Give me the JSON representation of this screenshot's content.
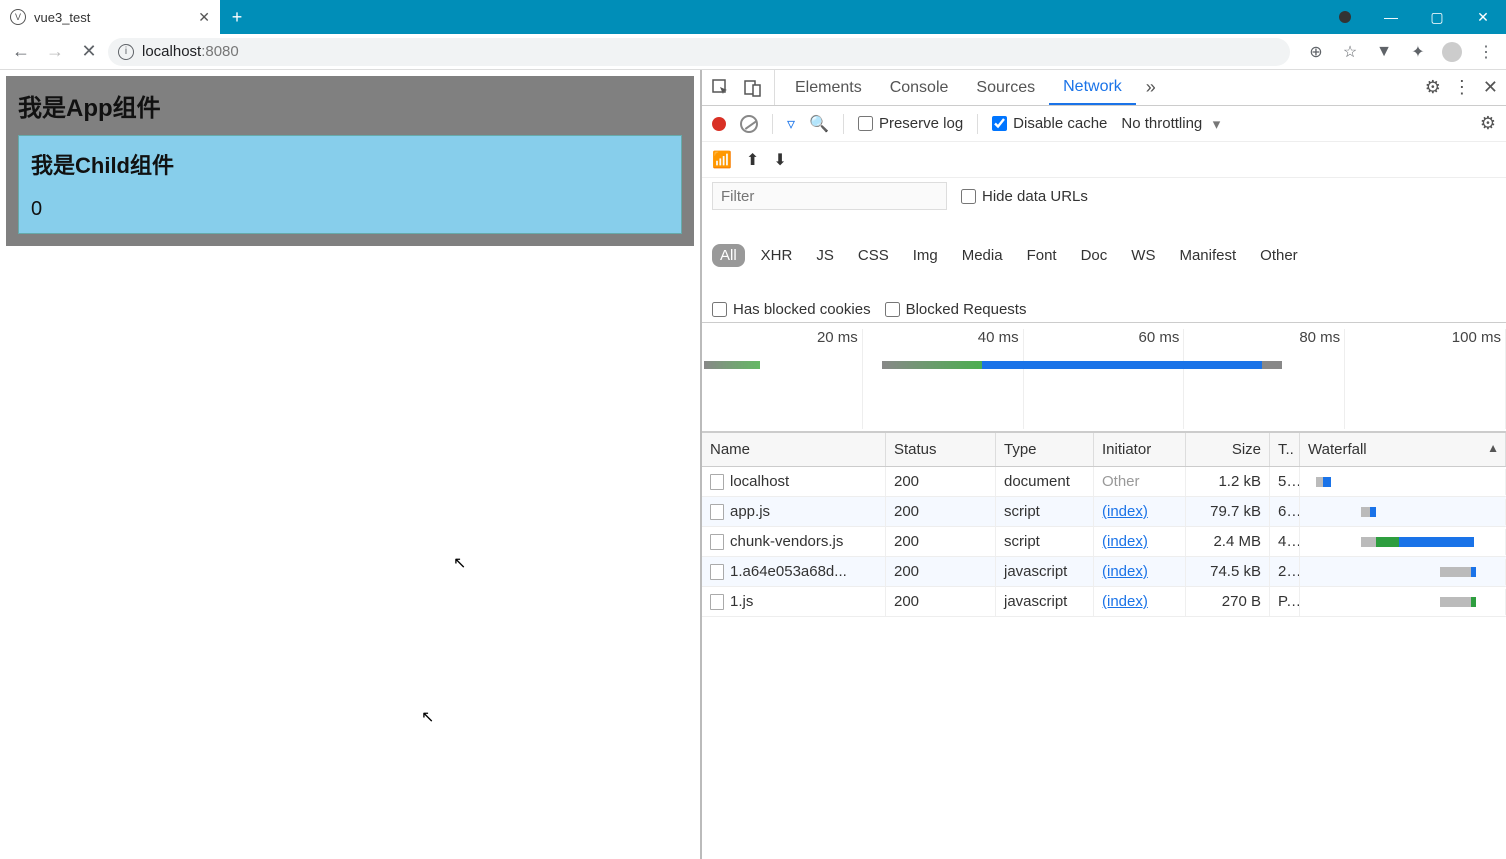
{
  "browser": {
    "tab_title": "vue3_test",
    "url_host": "localhost",
    "url_port": ":8080"
  },
  "page": {
    "app_heading": "我是App组件",
    "child_heading": "我是Child组件",
    "counter": "0"
  },
  "devtools": {
    "tabs": [
      "Elements",
      "Console",
      "Sources",
      "Network"
    ],
    "active_tab": "Network",
    "preserve_log": "Preserve log",
    "disable_cache": "Disable cache",
    "throttling": "No throttling",
    "filter_placeholder": "Filter",
    "hide_urls": "Hide data URLs",
    "type_filters": [
      "All",
      "XHR",
      "JS",
      "CSS",
      "Img",
      "Media",
      "Font",
      "Doc",
      "WS",
      "Manifest",
      "Other"
    ],
    "blocked_cookies": "Has blocked cookies",
    "blocked_requests": "Blocked Requests",
    "timeline_ticks": [
      "20 ms",
      "40 ms",
      "60 ms",
      "80 ms",
      "100 ms"
    ],
    "columns": {
      "name": "Name",
      "status": "Status",
      "type": "Type",
      "initiator": "Initiator",
      "size": "Size",
      "time": "T..",
      "waterfall": "Waterfall"
    },
    "rows": [
      {
        "name": "localhost",
        "status": "200",
        "type": "document",
        "initiator": "Other",
        "initiator_other": true,
        "size": "1.2 kB",
        "time": "5...",
        "wf": {
          "l": 4,
          "gray": 4,
          "blue": 4
        }
      },
      {
        "name": "app.js",
        "status": "200",
        "type": "script",
        "initiator": "(index)",
        "size": "79.7 kB",
        "time": "6...",
        "wf": {
          "l": 28,
          "gray": 5,
          "blue": 3
        }
      },
      {
        "name": "chunk-vendors.js",
        "status": "200",
        "type": "script",
        "initiator": "(index)",
        "size": "2.4 MB",
        "time": "4...",
        "wf": {
          "l": 28,
          "gray": 8,
          "green": 12,
          "blue": 40
        }
      },
      {
        "name": "1.a64e053a68d...",
        "status": "200",
        "type": "javascript",
        "initiator": "(index)",
        "size": "74.5 kB",
        "time": "2...",
        "wf": {
          "l": 70,
          "gray": 16,
          "blue": 3
        }
      },
      {
        "name": "1.js",
        "status": "200",
        "type": "javascript",
        "initiator": "(index)",
        "size": "270 B",
        "time": "P...",
        "wf": {
          "l": 70,
          "gray": 16,
          "green": 3
        }
      }
    ]
  }
}
